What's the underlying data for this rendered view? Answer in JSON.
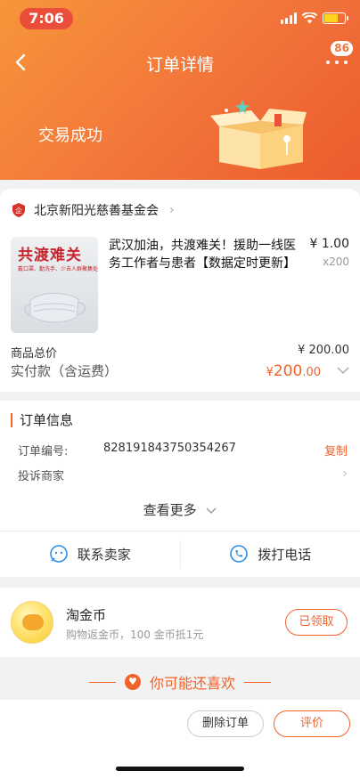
{
  "status_bar": {
    "time": "7:06"
  },
  "header": {
    "title": "订单详情",
    "message_badge": "86",
    "trade_status": "交易成功"
  },
  "shop": {
    "name": "北京新阳光慈善基金会",
    "product": {
      "image_title": "共渡难关",
      "image_subtitle": "戴口罩、勤洗手、少去人群聚集处",
      "title": "武汉加油，共渡难关！援助一线医务工作者与患者【数据定时更新】",
      "price": "¥ 1.00",
      "quantity": "x200"
    },
    "total_label": "商品总价",
    "total_value": "¥ 200.00",
    "paid_label": "实付款（含运费）",
    "paid_currency": "¥",
    "paid_int": "200",
    "paid_dec": ".00"
  },
  "order_info": {
    "title": "订单信息",
    "order_no_label": "订单编号:",
    "order_no": "828191843750354267",
    "copy_label": "复制",
    "complaint_label": "投诉商家",
    "see_more_label": "查看更多",
    "contact_seller_label": "联系卖家",
    "call_label": "拨打电话"
  },
  "coin": {
    "title": "淘金币",
    "subtitle": "购物返金币，100 金币抵1元",
    "claimed_label": "已领取"
  },
  "recommend": {
    "label": "你可能还喜欢"
  },
  "actions": {
    "delete_label": "删除订单",
    "review_label": "评价"
  },
  "colors": {
    "accent": "#f2622b",
    "header_start": "#f7953a",
    "header_end": "#ec5b2e"
  }
}
